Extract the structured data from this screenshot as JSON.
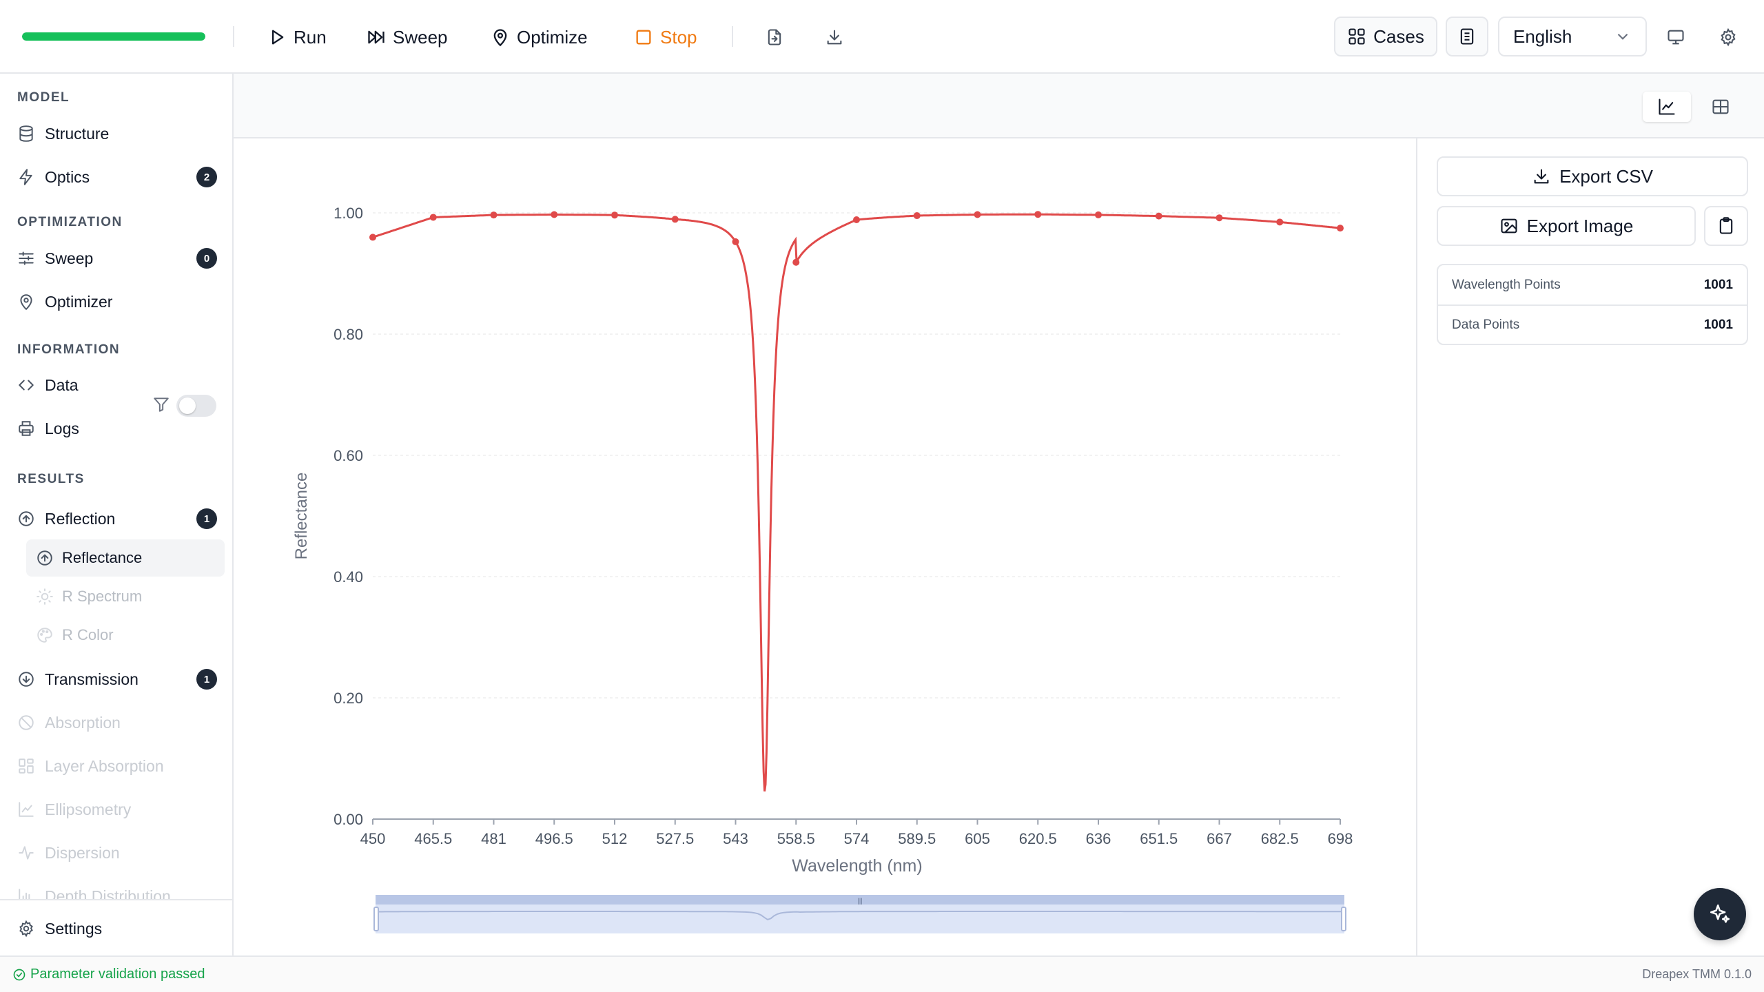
{
  "toolbar": {
    "progress": 1.0,
    "run_label": "Run",
    "sweep_label": "Sweep",
    "optimize_label": "Optimize",
    "stop_label": "Stop",
    "cases_label": "Cases",
    "language": "English",
    "accent_progress": "#16c05a",
    "stop_color": "#f07a12"
  },
  "sidebar": {
    "model_section": "MODEL",
    "structure": "Structure",
    "optics": "Optics",
    "optics_badge": "2",
    "optimization_section": "OPTIMIZATION",
    "sweep": "Sweep",
    "sweep_badge": "0",
    "optimizer": "Optimizer",
    "information_section": "INFORMATION",
    "data": "Data",
    "logs": "Logs",
    "results_section": "RESULTS",
    "results_filter_on": false,
    "reflection": "Reflection",
    "reflection_badge": "1",
    "reflectance": "Reflectance",
    "r_spectrum": "R Spectrum",
    "r_color": "R Color",
    "transmission": "Transmission",
    "transmission_badge": "1",
    "absorption": "Absorption",
    "layer_absorption": "Layer Absorption",
    "ellipsometry": "Ellipsometry",
    "dispersion": "Dispersion",
    "depth_distribution": "Depth Distribution",
    "settings": "Settings"
  },
  "right_panel": {
    "export_csv": "Export CSV",
    "export_image": "Export Image",
    "stats": [
      {
        "label": "Wavelength Points",
        "value": "1001"
      },
      {
        "label": "Data Points",
        "value": "1001"
      }
    ]
  },
  "status": {
    "message": "Parameter validation passed",
    "version": "Dreapex TMM 0.1.0"
  },
  "chart_data": {
    "type": "line",
    "xlabel": "Wavelength (nm)",
    "ylabel": "Reflectance",
    "x_ticks": [
      "450",
      "465.5",
      "481",
      "496.5",
      "512",
      "527.5",
      "543",
      "558.5",
      "574",
      "589.5",
      "605",
      "620.5",
      "636",
      "651.5",
      "667",
      "682.5",
      "698"
    ],
    "y_ticks": [
      "0.00",
      "0.20",
      "0.40",
      "0.60",
      "0.80",
      "1.00"
    ],
    "xlim": [
      450,
      698
    ],
    "ylim": [
      0,
      1.1
    ],
    "grid": true,
    "line_color": "#e04a4a",
    "series": [
      {
        "x": [
          450,
          465.5,
          481,
          496.5,
          512,
          527.5,
          543,
          550.5,
          558.5,
          574,
          589.5,
          605,
          620.5,
          636,
          651.5,
          667,
          682.5,
          698
        ],
        "y": [
          0.96,
          0.993,
          0.997,
          0.998,
          0.998,
          0.994,
          0.94,
          0.045,
          0.955,
          0.993,
          0.997,
          0.998,
          0.998,
          0.997,
          0.995,
          0.992,
          0.985,
          0.975
        ]
      }
    ],
    "markers_x": [
      450,
      465.5,
      481,
      496.5,
      512,
      527.5,
      543,
      558.5,
      574,
      589.5,
      605,
      620.5,
      636,
      651.5,
      667,
      682.5,
      698
    ],
    "zoom_slider": {
      "start": 0,
      "end": 1
    }
  }
}
